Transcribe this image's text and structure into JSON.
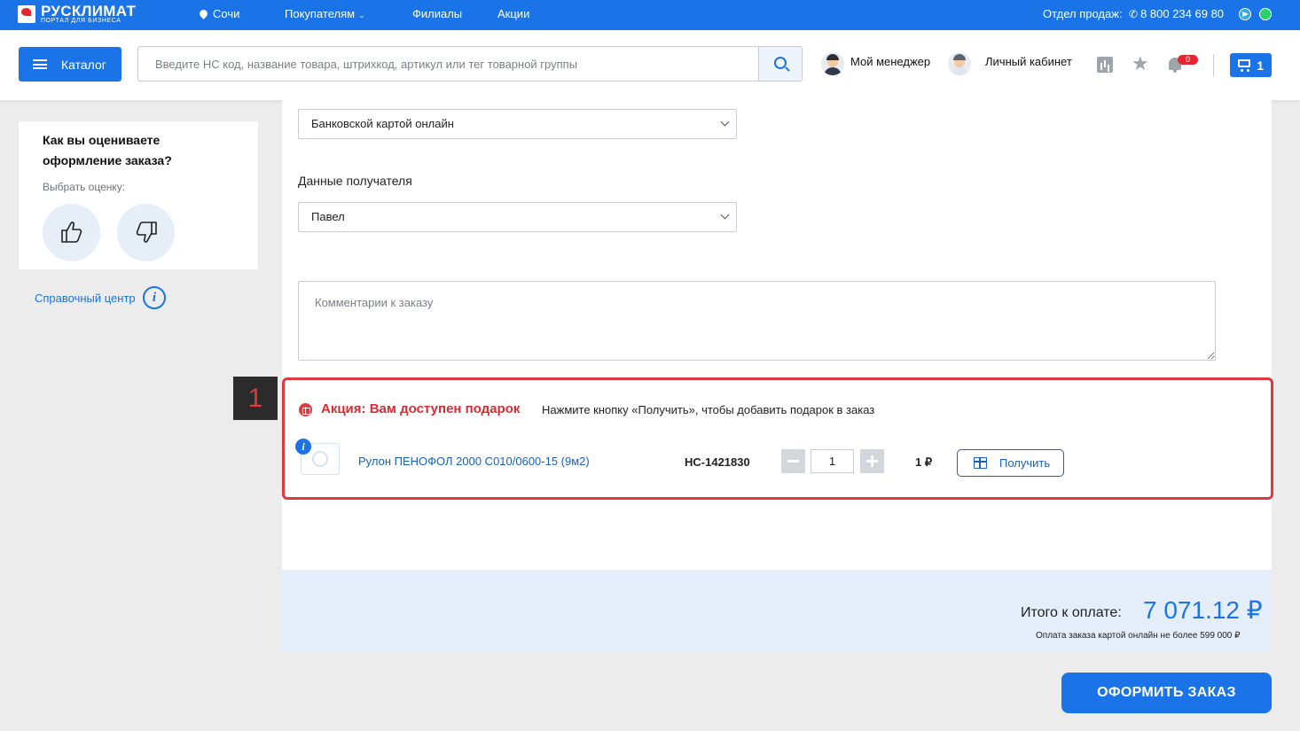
{
  "topbar": {
    "logo_title": "РУСКЛИМАТ",
    "logo_sub": "ПОРТАЛ ДЛЯ БИЗНЕСА",
    "city": "Сочи",
    "nav": [
      "Покупателям",
      "Филиалы",
      "Акции"
    ],
    "sales_label": "Отдел продаж:",
    "phone": "8 800 234 69 80"
  },
  "header": {
    "catalog_label": "Каталог",
    "search_placeholder": "Введите НС код, название товара, штрихкод, артикул или тег товарной группы",
    "manager_label": "Мой менеджер",
    "cabinet_label": "Личный кабинет",
    "notifications_count": "0",
    "cart_count": "1"
  },
  "sidebar": {
    "rating_title": "Как вы оцениваете оформление заказа?",
    "rating_sub": "Выбрать оценку:",
    "help_label": "Справочный центр"
  },
  "form": {
    "payment_selected": "Банковской картой онлайн",
    "recipient_label": "Данные получателя",
    "recipient_selected": "Павел",
    "comment_placeholder": "Комментарии к заказу"
  },
  "promo": {
    "marker": "1",
    "title": "Акция: Вам доступен подарок",
    "description": "Нажмите кнопку «Получить», чтобы добавить подарок в заказ",
    "product_name": "Рулон ПЕНОФОЛ 2000 С010/0600-15 (9м2)",
    "product_code": "НС-1421830",
    "quantity": "1",
    "price": "1 ₽",
    "get_label": "Получить"
  },
  "total": {
    "label": "Итого к оплате:",
    "value": "7 071.12 ₽",
    "note": "Оплата заказа картой онлайн не более 599 000 ₽"
  },
  "order_button": "ОФОРМИТЬ ЗАКАЗ",
  "colors": {
    "brand_blue": "#1a74e8",
    "promo_red": "#e0393e"
  }
}
